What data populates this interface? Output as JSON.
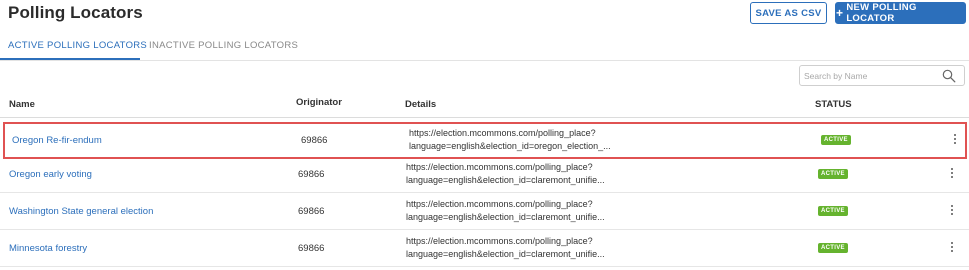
{
  "header": {
    "title": "Polling Locators",
    "save_csv_label": "SAVE AS CSV",
    "new_locator_label": "NEW POLLING LOCATOR",
    "new_locator_icon": "+"
  },
  "tabs": [
    {
      "label": "ACTIVE POLLING LOCATORS",
      "active": true
    },
    {
      "label": "INACTIVE POLLING LOCATORS",
      "active": false
    }
  ],
  "search": {
    "placeholder": "Search by Name",
    "value": ""
  },
  "table": {
    "columns": {
      "name": "Name",
      "originator": "Originator",
      "details": "Details",
      "status": "STATUS"
    },
    "rows": [
      {
        "name": "Oregon Re-fir-endum",
        "originator": "69866",
        "details_line1": "https://election.mcommons.com/polling_place?",
        "details_line2": "language=english&election_id=oregon_election_...",
        "status": "ACTIVE"
      },
      {
        "name": "Oregon early voting",
        "originator": "69866",
        "details_line1": "https://election.mcommons.com/polling_place?",
        "details_line2": "language=english&election_id=claremont_unifie...",
        "status": "ACTIVE"
      },
      {
        "name": "Washington State general election",
        "originator": "69866",
        "details_line1": "https://election.mcommons.com/polling_place?",
        "details_line2": "language=english&election_id=claremont_unifie...",
        "status": "ACTIVE"
      },
      {
        "name": "Minnesota forestry",
        "originator": "69866",
        "details_line1": "https://election.mcommons.com/polling_place?",
        "details_line2": "language=english&election_id=claremont_unifie...",
        "status": "ACTIVE"
      }
    ]
  },
  "colors": {
    "accent": "#2c6fbb",
    "status_active": "#65b32e",
    "highlight_border": "#e05252"
  },
  "icons": {
    "search": "search-icon",
    "row_menu": "kebab-menu-icon"
  }
}
